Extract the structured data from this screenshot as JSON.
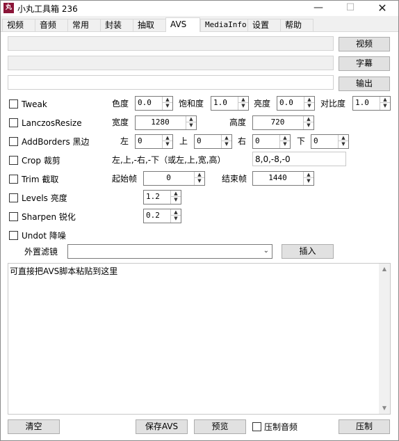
{
  "window": {
    "title": "小丸工具箱 236",
    "icon_text": "丸",
    "min_symbol": "—",
    "max_symbol": "☐",
    "close_symbol": "✕"
  },
  "tabs": [
    "视频",
    "音频",
    "常用",
    "封装",
    "抽取",
    "AVS",
    "MediaInfo",
    "设置",
    "帮助"
  ],
  "active_tab": "AVS",
  "file_buttons": {
    "video": "视频",
    "subtitle": "字幕",
    "output": "输出"
  },
  "filters": {
    "tweak": {
      "label": "Tweak",
      "hue_label": "色度",
      "hue_value": "0.0",
      "saturation_label": "饱和度",
      "saturation_value": "1.0",
      "brightness_label": "亮度",
      "brightness_value": "0.0",
      "contrast_label": "对比度",
      "contrast_value": "1.0"
    },
    "lanczos": {
      "label": "LanczosResize",
      "width_label": "宽度",
      "width_value": "1280",
      "height_label": "高度",
      "height_value": "720"
    },
    "addborders": {
      "label": "AddBorders 黑边",
      "left_label": "左",
      "left_value": "0",
      "top_label": "上",
      "top_value": "0",
      "right_label": "右",
      "right_value": "0",
      "bottom_label": "下",
      "bottom_value": "0"
    },
    "crop": {
      "label": "Crop 裁剪",
      "hint": "左,上,-右,-下（或左,上,宽,高）",
      "value": "8,0,-8,-0"
    },
    "trim": {
      "label": "Trim 截取",
      "start_label": "起始帧",
      "start_value": "0",
      "end_label": "结束帧",
      "end_value": "1440"
    },
    "levels": {
      "label": "Levels 亮度",
      "value": "1.2"
    },
    "sharpen": {
      "label": "Sharpen 锐化",
      "value": "0.2"
    },
    "undot": {
      "label": "Undot 降噪"
    }
  },
  "external_filter": {
    "label": "外置滤镜",
    "selected": "",
    "insert_button": "插入"
  },
  "script_editor": {
    "text": "可直接把AVS脚本粘贴到这里"
  },
  "bottom": {
    "clear_button": "清空",
    "save_avs_button": "保存AVS",
    "preview_button": "预览",
    "mux_audio_label": "压制音频",
    "encode_button": "压制"
  }
}
